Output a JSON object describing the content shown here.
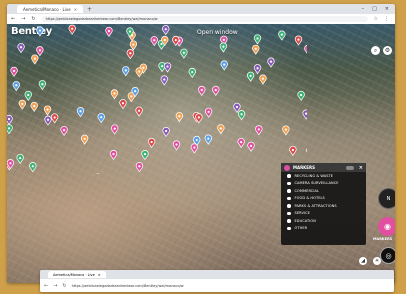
{
  "browser": {
    "tab_title": "Aemetica/Monaco · Live",
    "url": "https://aeblicaelegodarbearikerbear.com/Bentley/wal/monaco/w"
  },
  "map": {
    "brand": "Bentley",
    "open_window": "Open window"
  },
  "markers_panel": {
    "title": "MARKERS",
    "categories": [
      "RECYCLING & WASTE",
      "CAMERA SURVEILLANCE",
      "COMMERCIAL",
      "FOOD & HOTELS",
      "PARKS & ATTRACTIONS",
      "SERVICE",
      "EDUCATION",
      "OTHER"
    ]
  },
  "controls": {
    "markers_button_label": "MARKERS"
  },
  "bottom_browser": {
    "tab_title": "Aemetica/Monaco · Live",
    "url": "https://aeblicaelegodarbearikerbear.com/Bentley/wal/monaco/w"
  },
  "colors": {
    "pink": "#e04fa0",
    "orange": "#f0a050",
    "green": "#3bb273",
    "blue": "#5aa0e6",
    "purple": "#8a5ab8",
    "red": "#d94b4b"
  }
}
